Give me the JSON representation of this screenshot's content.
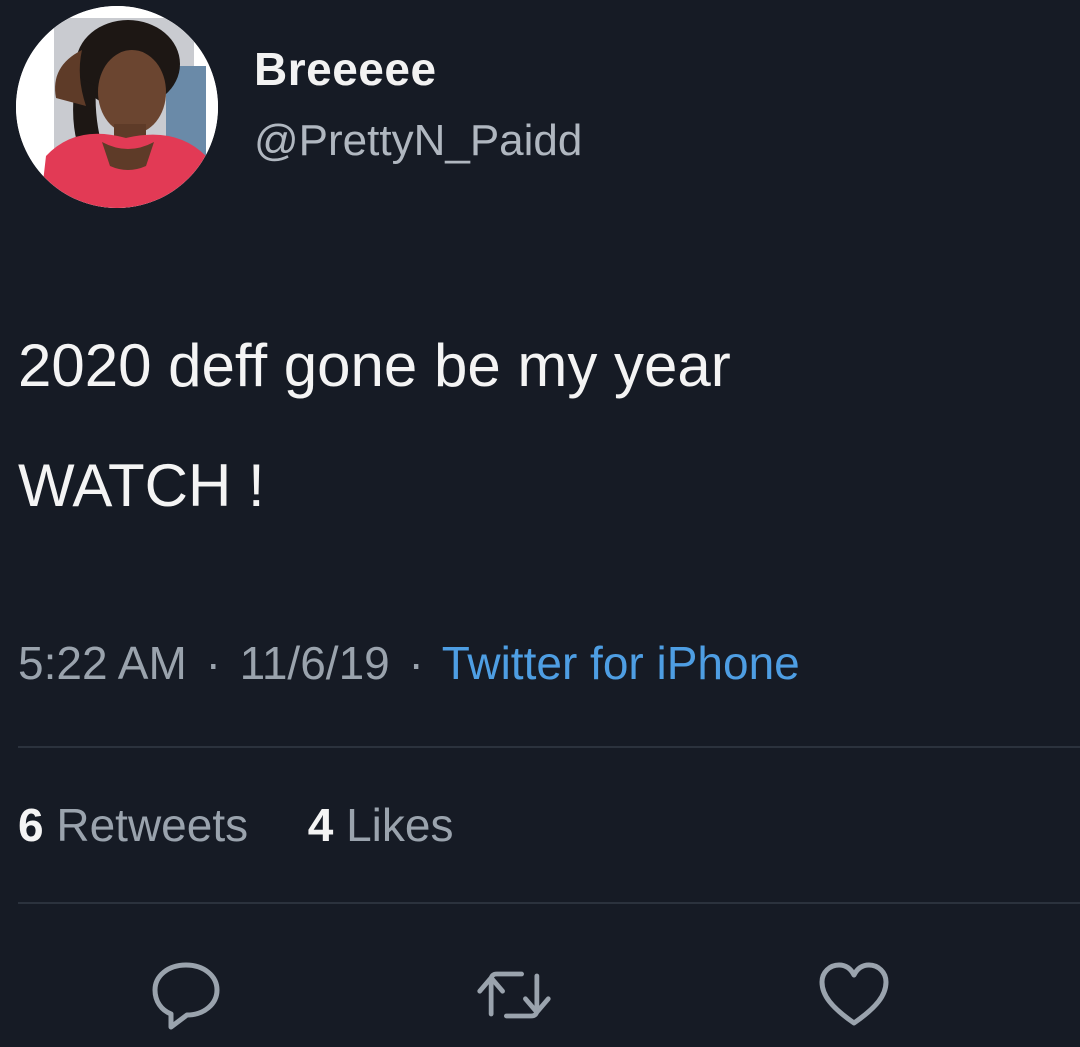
{
  "user": {
    "display_name": "Breeeee",
    "handle": "@PrettyN_Paidd",
    "avatar_icon": "profile-photo"
  },
  "tweet": {
    "text_lines": [
      "2020 deff gone be my year",
      "WATCH !"
    ],
    "time": "5:22 AM",
    "date": "11/6/19",
    "separator": "·",
    "source": "Twitter for iPhone"
  },
  "stats": {
    "retweets_count": "6",
    "retweets_label": "Retweets",
    "likes_count": "4",
    "likes_label": "Likes"
  },
  "actions": {
    "reply_icon": "reply-icon",
    "retweet_icon": "retweet-icon",
    "like_icon": "heart-icon"
  },
  "colors": {
    "background": "#161b25",
    "link": "#4e9ee3",
    "muted": "#9aa3ad"
  }
}
